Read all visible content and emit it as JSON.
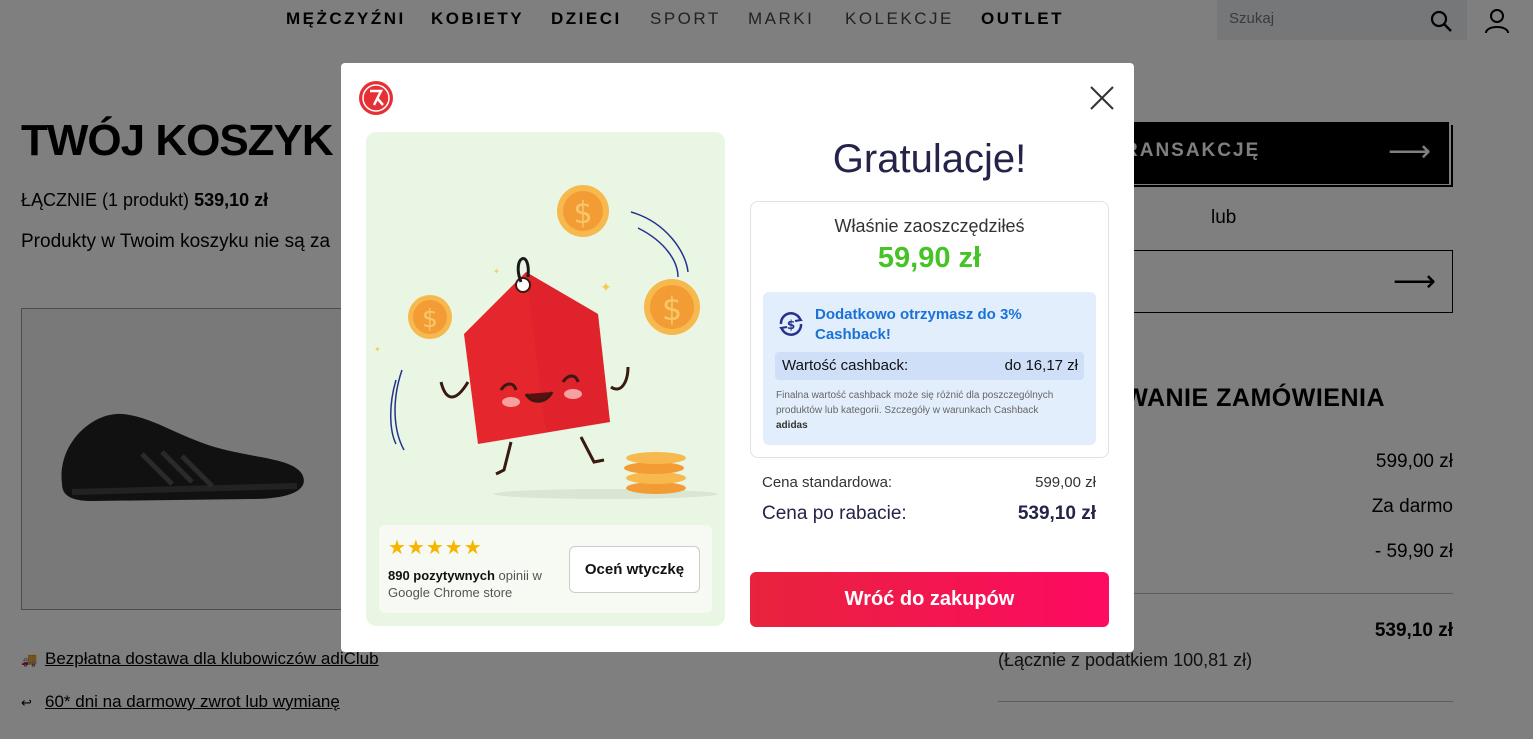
{
  "nav": {
    "items": [
      "MĘŻCZYŹNI",
      "KOBIETY",
      "DZIECI",
      "SPORT",
      "MARKI",
      "KOLEKCJE",
      "OUTLET"
    ],
    "search_placeholder": "Szukaj"
  },
  "cart": {
    "title": "TWÓJ KOSZYK",
    "total_label": "ŁĄCZNIE (1 produkt)",
    "total_value": "539,10 zł",
    "note": "Produkty w Twoim koszyku nie są za"
  },
  "info_links": [
    "Bezpłatna dostawa dla klubowiczów adiClub",
    "60* dni na darmowy zwrot lub wymianę"
  ],
  "checkout": {
    "button_label": "RANSAKCJĘ",
    "or_label": "lub"
  },
  "summary": {
    "title": "WANIE ZAMÓWIENIA",
    "values": [
      "599,00 zł",
      "Za darmo",
      "- 59,90 zł"
    ],
    "total": "539,10 zł",
    "tax": "(Łącznie z podatkiem  100,81 zł)"
  },
  "modal": {
    "congrats": "Gratulacje!",
    "saved_label": "Właśnie zaoszczędziłeś",
    "saved_amount": "59,90 zł",
    "cashback_title": "Dodatkowo otrzymasz do 3% Cashback!",
    "cashback_value_label": "Wartość cashback:",
    "cashback_value": "do 16,17 zł",
    "cashback_fine": "Finalna wartość cashback może się różnić dla poszczególnych produktów lub kategorii. Szczegóły w warunkach Cashback",
    "cashback_brand": "adidas",
    "price_std_label": "Cena standardowa:",
    "price_std_value": "599,00 zł",
    "price_disc_label": "Cena po rabacie:",
    "price_disc_value": "539,10 zł",
    "back_button": "Wróć do zakupów",
    "stars": "★★★★★",
    "rating_bold": "890 pozytywnych",
    "rating_rest": " opinii w Google Chrome store",
    "rate_button": "Oceń wtyczkę"
  },
  "colors": {
    "accent_red": "#e53036",
    "saved_green": "#45c425",
    "cashback_blue": "#1a72d6",
    "button_gradient_start": "#e8233c",
    "button_gradient_end": "#fd0a62"
  }
}
